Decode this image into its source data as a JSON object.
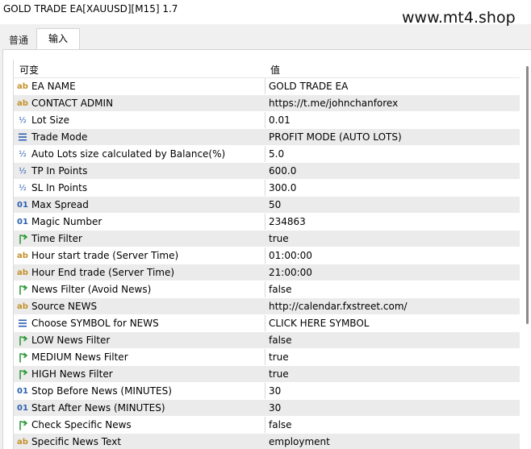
{
  "window": {
    "title": "GOLD TRADE EA[XAUUSD][M15] 1.7"
  },
  "watermark": "www.mt4.shop",
  "tabs": [
    {
      "label": "普通",
      "active": false
    },
    {
      "label": "输入",
      "active": true
    }
  ],
  "table": {
    "columns": [
      "可变",
      "值"
    ],
    "rows": [
      {
        "icon": "ab",
        "name": "EA NAME",
        "value": "GOLD TRADE EA"
      },
      {
        "icon": "ab",
        "name": "CONTACT ADMIN",
        "value": "https://t.me/johnchanforex"
      },
      {
        "icon": "half",
        "name": "Lot Size",
        "value": "0.01"
      },
      {
        "icon": "enum",
        "name": "Trade Mode",
        "value": "PROFIT MODE (AUTO LOTS)"
      },
      {
        "icon": "half",
        "name": "Auto Lots size calculated by Balance(%)",
        "value": "5.0"
      },
      {
        "icon": "half",
        "name": "TP In Points",
        "value": "600.0"
      },
      {
        "icon": "half",
        "name": "SL In Points",
        "value": "300.0"
      },
      {
        "icon": "01",
        "name": "Max Spread",
        "value": "50"
      },
      {
        "icon": "01",
        "name": "Magic Number",
        "value": "234863"
      },
      {
        "icon": "bool",
        "name": "Time Filter",
        "value": "true"
      },
      {
        "icon": "ab",
        "name": "Hour start trade (Server Time)",
        "value": "01:00:00"
      },
      {
        "icon": "ab",
        "name": "Hour End trade (Server Time)",
        "value": "21:00:00"
      },
      {
        "icon": "bool",
        "name": "News Filter (Avoid News)",
        "value": "false"
      },
      {
        "icon": "ab",
        "name": "Source NEWS",
        "value": "http://calendar.fxstreet.com/"
      },
      {
        "icon": "enum",
        "name": "Choose SYMBOL for NEWS",
        "value": "CLICK HERE SYMBOL"
      },
      {
        "icon": "bool",
        "name": "LOW News Filter",
        "value": "false"
      },
      {
        "icon": "bool",
        "name": "MEDIUM News Filter",
        "value": "true"
      },
      {
        "icon": "bool",
        "name": "HIGH News Filter",
        "value": "true"
      },
      {
        "icon": "01",
        "name": "Stop Before News (MINUTES)",
        "value": "30"
      },
      {
        "icon": "01",
        "name": "Start After News (MINUTES)",
        "value": "30"
      },
      {
        "icon": "bool",
        "name": "Check Specific News",
        "value": "false"
      },
      {
        "icon": "ab",
        "name": "Specific News Text",
        "value": "employment"
      }
    ]
  },
  "icons": {
    "ab": "string-type-icon",
    "half": "double-type-icon",
    "01": "integer-type-icon",
    "enum": "enum-type-icon",
    "bool": "bool-type-icon"
  },
  "colors": {
    "row_alt": "#ebebeb",
    "icon_blue": "#2b5fb0",
    "icon_orange": "#c4902c",
    "icon_green": "#2e9a3a"
  }
}
